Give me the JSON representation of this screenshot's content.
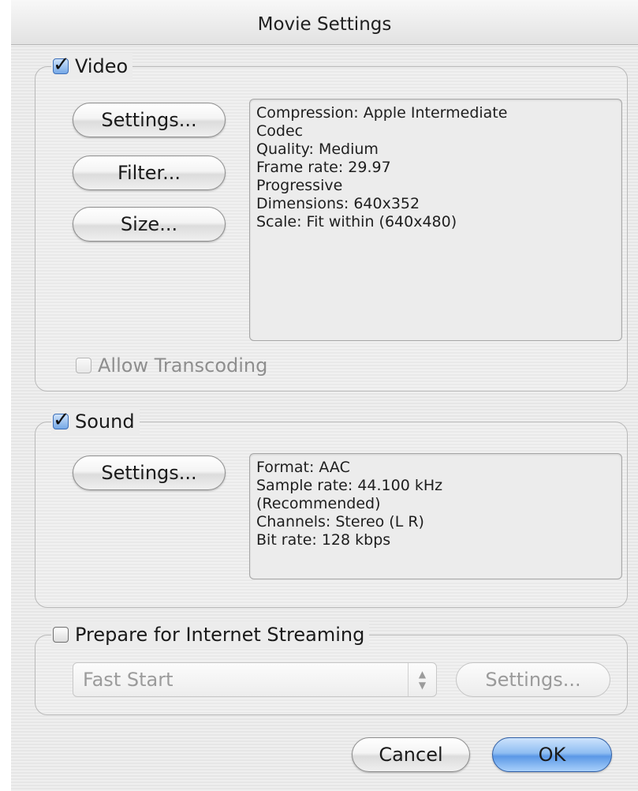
{
  "dialog": {
    "title": "Movie Settings"
  },
  "video": {
    "label": "Video",
    "checked": true,
    "buttons": {
      "settings": "Settings...",
      "filter": "Filter...",
      "size": "Size..."
    },
    "info": [
      "Compression: Apple Intermediate",
      "Codec",
      "Quality: Medium",
      "Frame rate: 29.97",
      "Progressive",
      "Dimensions: 640x352",
      "Scale: Fit within (640x480)"
    ],
    "allow_transcoding": {
      "label": "Allow Transcoding",
      "checked": false,
      "enabled": false
    }
  },
  "sound": {
    "label": "Sound",
    "checked": true,
    "buttons": {
      "settings": "Settings..."
    },
    "info": [
      "Format: AAC",
      "Sample rate: 44.100 kHz",
      "(Recommended)",
      "Channels: Stereo (L R)",
      "Bit rate: 128 kbps"
    ]
  },
  "streaming": {
    "label": "Prepare for Internet Streaming",
    "checked": false,
    "popup_value": "Fast Start",
    "settings_label": "Settings...",
    "enabled": false
  },
  "footer": {
    "cancel_label": "Cancel",
    "ok_label": "OK"
  },
  "icons": {
    "checkbox_checked": "checkmark-icon",
    "popup_arrows": "up-down-arrows-icon"
  },
  "colors": {
    "accent": "#5b98e6"
  }
}
